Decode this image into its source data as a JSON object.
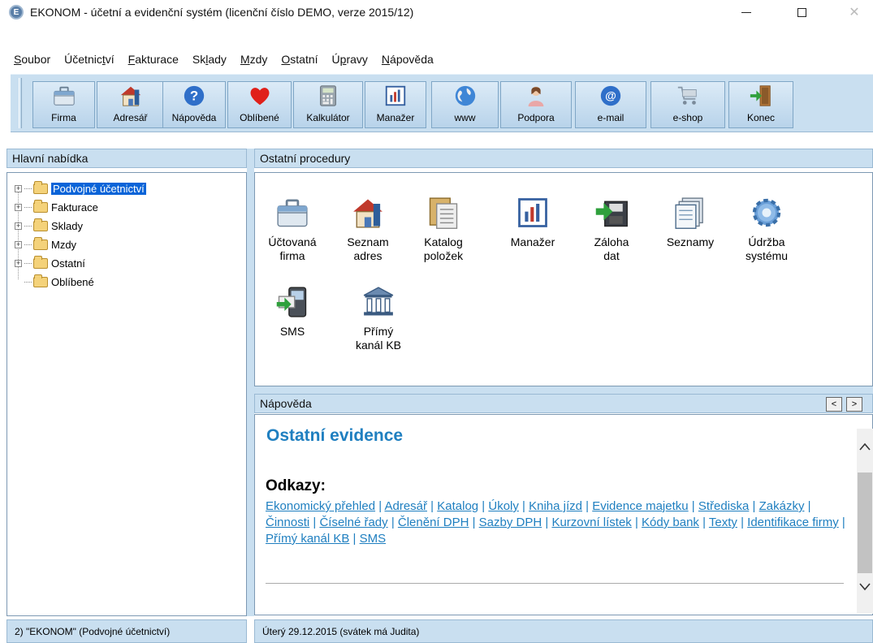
{
  "window": {
    "title": "EKONOM - účetní a evidenční systém (licenční číslo DEMO, verze 2015/12)",
    "minimize": "—",
    "close": "✕"
  },
  "menu": [
    {
      "label": "Soubor",
      "underline_index": 0
    },
    {
      "label": "Účetnictví",
      "underline_index": 7
    },
    {
      "label": "Fakturace",
      "underline_index": 0
    },
    {
      "label": "Sklady",
      "underline_index": 2
    },
    {
      "label": "Mzdy",
      "underline_index": 0
    },
    {
      "label": "Ostatní",
      "underline_index": 0
    },
    {
      "label": "Úpravy",
      "underline_index": 1
    },
    {
      "label": "Nápověda",
      "underline_index": 0
    }
  ],
  "toolbar": [
    {
      "label": "Firma",
      "icon": "briefcase-icon"
    },
    {
      "label": "Adresář",
      "icon": "house-icon"
    },
    {
      "label": "Nápověda",
      "icon": "help-icon"
    },
    {
      "label": "Oblíbené",
      "icon": "heart-icon"
    },
    {
      "label": "Kalkulátor",
      "icon": "calculator-icon"
    },
    {
      "label": "Manažer",
      "icon": "chart-icon"
    },
    {
      "label": "www",
      "icon": "globe-icon"
    },
    {
      "label": "Podpora",
      "icon": "support-person-icon"
    },
    {
      "label": "e-mail",
      "icon": "email-at-icon"
    },
    {
      "label": "e-shop",
      "icon": "cart-icon"
    },
    {
      "label": "Konec",
      "icon": "exit-door-icon"
    }
  ],
  "left_panel": {
    "title": "Hlavní nabídka",
    "tree": [
      {
        "label": "Podvojné účetnictví",
        "expandable": true,
        "selected": true
      },
      {
        "label": "Fakturace",
        "expandable": true,
        "selected": false
      },
      {
        "label": "Sklady",
        "expandable": true,
        "selected": false
      },
      {
        "label": "Mzdy",
        "expandable": true,
        "selected": false
      },
      {
        "label": "Ostatní",
        "expandable": true,
        "selected": false
      },
      {
        "label": "Oblíbené",
        "expandable": false,
        "selected": false
      }
    ]
  },
  "procedures": {
    "title": "Ostatní procedury",
    "items": [
      {
        "line1": "Účtovaná",
        "line2": "firma",
        "icon": "briefcase-icon"
      },
      {
        "line1": "Seznam",
        "line2": "adres",
        "icon": "house-icon"
      },
      {
        "line1": "Katalog",
        "line2": "položek",
        "icon": "catalog-icon"
      },
      {
        "line1": "Manažer",
        "line2": "",
        "icon": "chart-icon"
      },
      {
        "line1": "Záloha",
        "line2": "dat",
        "icon": "backup-disk-icon"
      },
      {
        "line1": "Seznamy",
        "line2": "",
        "icon": "lists-icon"
      },
      {
        "line1": "Údržba",
        "line2": "systému",
        "icon": "gear-icon"
      },
      {
        "line1": "SMS",
        "line2": "",
        "icon": "sms-phone-icon"
      },
      {
        "line1": "Přímý",
        "line2": "kanál KB",
        "icon": "bank-icon"
      }
    ]
  },
  "help": {
    "title": "Nápověda",
    "nav_prev": "<",
    "nav_next": ">",
    "heading": "Ostatní evidence",
    "links_heading": "Odkazy:",
    "links": [
      "Ekonomický přehled",
      "Adresář",
      "Katalog",
      "Úkoly",
      "Kniha jízd",
      "Evidence majetku",
      "Střediska",
      "Zakázky",
      "Činnosti",
      "Číselné řady",
      "Členění DPH",
      "Sazby DPH",
      "Kurzovní lístek",
      "Kódy bank",
      "Texty",
      "Identifikace firmy",
      "Přímý kanál KB",
      "SMS"
    ],
    "scroll_up": "^",
    "scroll_down": "v"
  },
  "status": {
    "left": "2) \"EKONOM\"  (Podvojné účetnictví)",
    "right": "Úterý 29.12.2015 (svátek má Judita)"
  },
  "colors": {
    "panel": "#c9dff0",
    "link": "#1f7fc0",
    "selection": "#0a64d8"
  }
}
